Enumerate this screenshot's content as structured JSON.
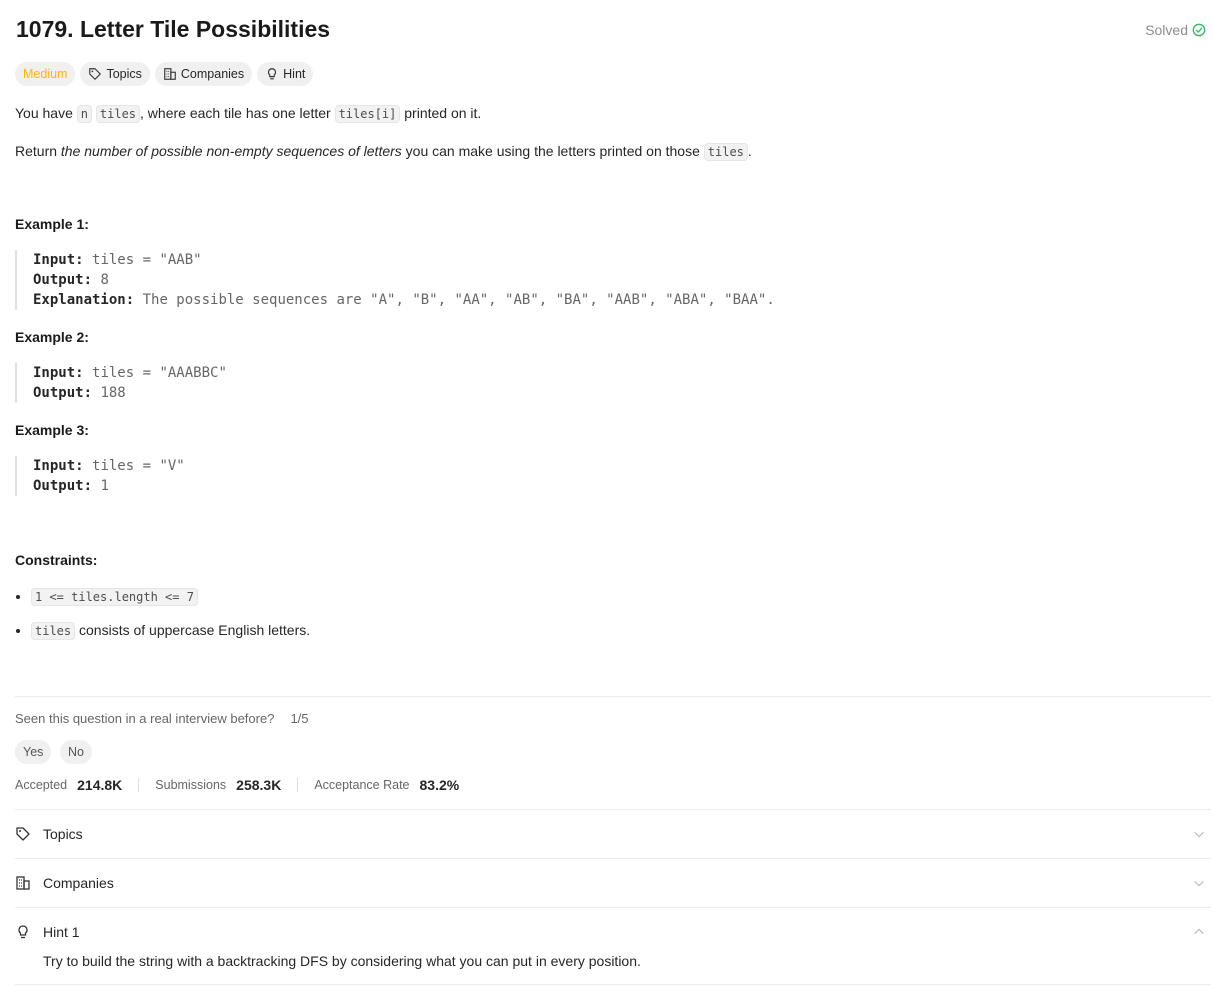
{
  "problem": {
    "title": "1079. Letter Tile Possibilities",
    "status": "Solved",
    "tags": {
      "difficulty": "Medium",
      "topics": "Topics",
      "companies": "Companies",
      "hint": "Hint"
    }
  },
  "description": {
    "p1": {
      "a": "You have ",
      "code1": "n",
      "code2": "tiles",
      "b": ", where each tile has one letter ",
      "code3": "tiles[i]",
      "c": " printed on it."
    },
    "p2": {
      "a": "Return ",
      "em": "the number of possible non-empty sequences of letters",
      "b": " you can make using the letters printed on those ",
      "code": "tiles",
      "c": "."
    }
  },
  "examples": [
    {
      "title": "Example 1:",
      "input_label": "Input:",
      "input": "tiles = \"AAB\"",
      "output_label": "Output:",
      "output": "8",
      "explanation_label": "Explanation:",
      "explanation": "The possible sequences are \"A\", \"B\", \"AA\", \"AB\", \"BA\", \"AAB\", \"ABA\", \"BAA\"."
    },
    {
      "title": "Example 2:",
      "input_label": "Input:",
      "input": "tiles = \"AAABBC\"",
      "output_label": "Output:",
      "output": "188"
    },
    {
      "title": "Example 3:",
      "input_label": "Input:",
      "input": "tiles = \"V\"",
      "output_label": "Output:",
      "output": "1"
    }
  ],
  "constraints": {
    "title": "Constraints:",
    "c1_code": "1 <= tiles.length <= 7",
    "c2_code": "tiles",
    "c2_text": " consists of uppercase English letters."
  },
  "interview": {
    "question": "Seen this question in a real interview before?",
    "count": "1/5",
    "yes": "Yes",
    "no": "No"
  },
  "stats": {
    "accepted_label": "Accepted",
    "accepted_value": "214.8K",
    "submissions_label": "Submissions",
    "submissions_value": "258.3K",
    "rate_label": "Acceptance Rate",
    "rate_value": "83.2%"
  },
  "accordion": {
    "topics": "Topics",
    "companies": "Companies",
    "hint1": "Hint 1",
    "hint1_text": "Try to build the string with a backtracking DFS by considering what you can put in every position."
  },
  "colors": {
    "medium": "#ffb800",
    "solved_check": "#2cbb5d"
  }
}
